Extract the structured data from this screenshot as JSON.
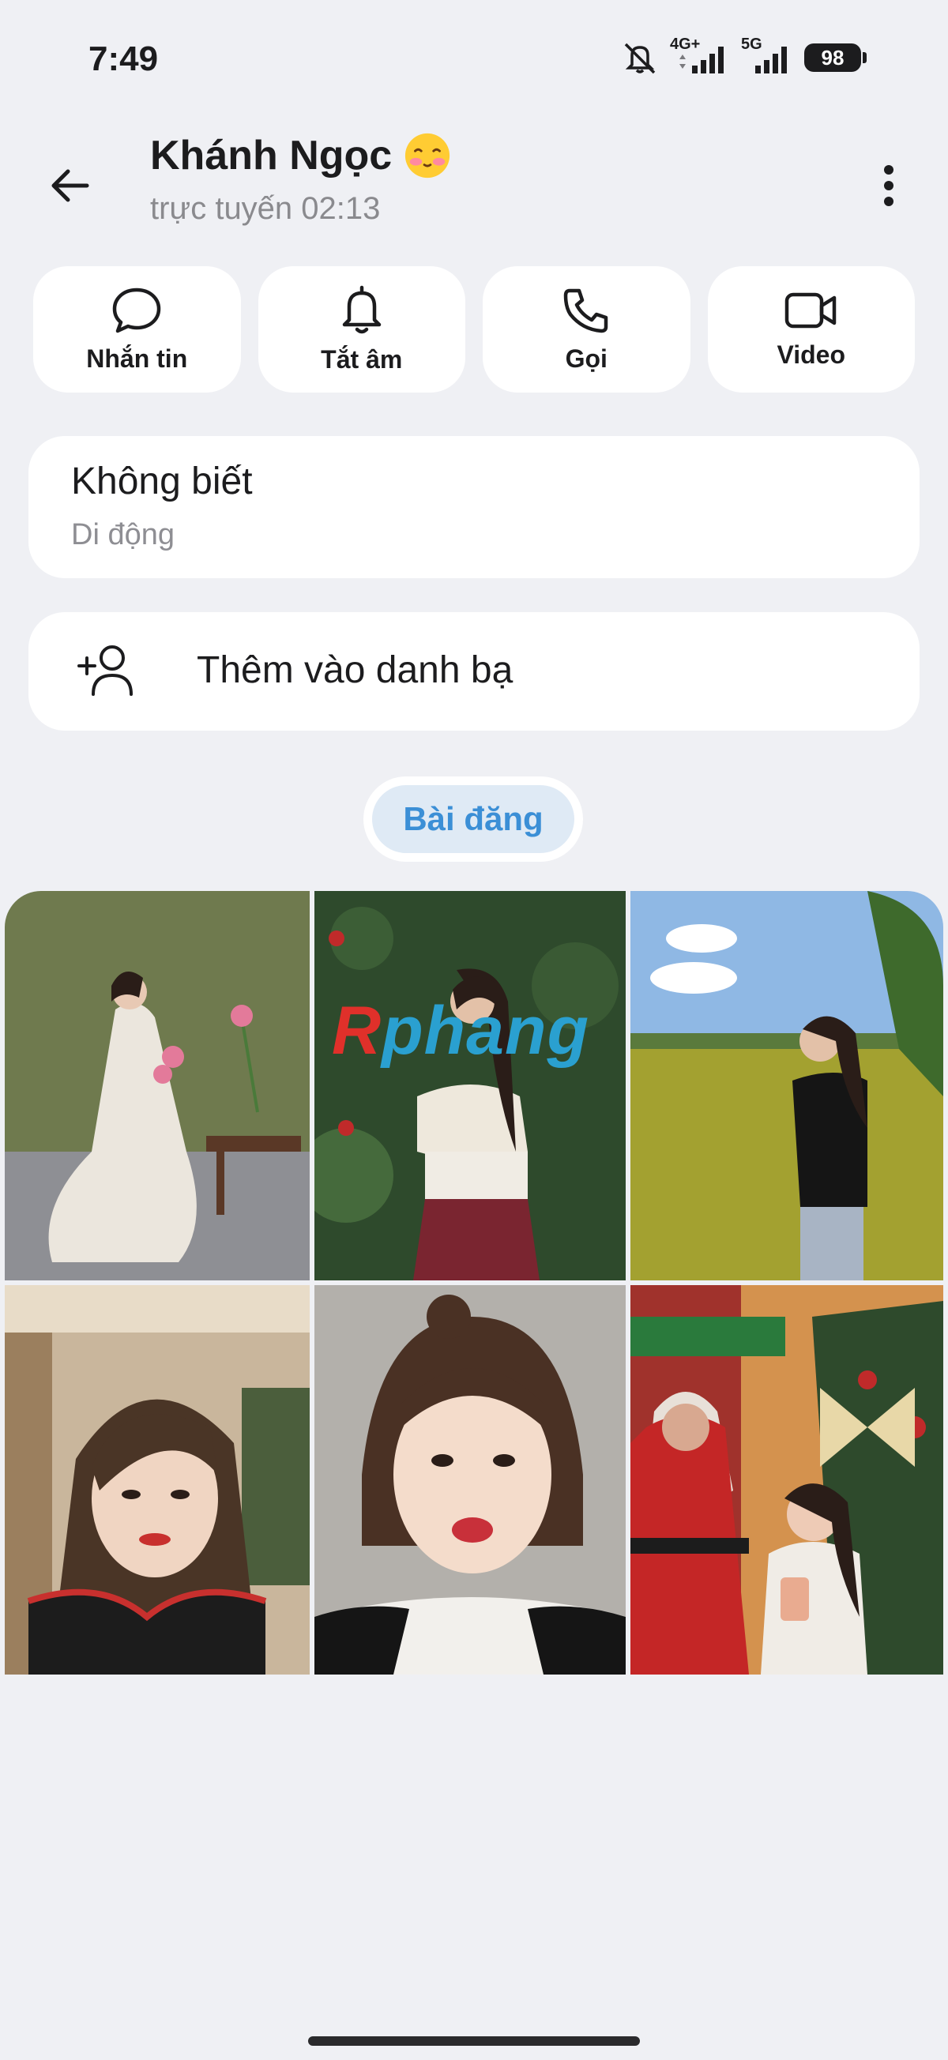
{
  "status_bar": {
    "time": "7:49",
    "network_1": "4G+",
    "network_2": "5G",
    "battery": "98"
  },
  "header": {
    "name": "Khánh Ngọc",
    "status": "trực tuyến 02:13",
    "icons": [
      "back-arrow-icon",
      "blushing-face-emoji",
      "more-vertical-icon"
    ]
  },
  "actions": [
    {
      "label": "Nhắn tin",
      "icon": "message-bubble-icon"
    },
    {
      "label": "Tắt âm",
      "icon": "bell-icon"
    },
    {
      "label": "Gọi",
      "icon": "phone-icon"
    },
    {
      "label": "Video",
      "icon": "video-camera-icon"
    }
  ],
  "phone": {
    "value": "Không biết",
    "type": "Di động"
  },
  "add_contact": {
    "label": "Thêm vào danh bạ",
    "icon": "add-person-icon"
  },
  "tabs": {
    "posts": "Bài đăng"
  },
  "photos": {
    "watermark_r": "R",
    "watermark_rest": "phang"
  },
  "colors": {
    "background": "#eff0f4",
    "card": "#ffffff",
    "accent": "#3b8fd6",
    "accent_bg": "#dfeaf5"
  }
}
